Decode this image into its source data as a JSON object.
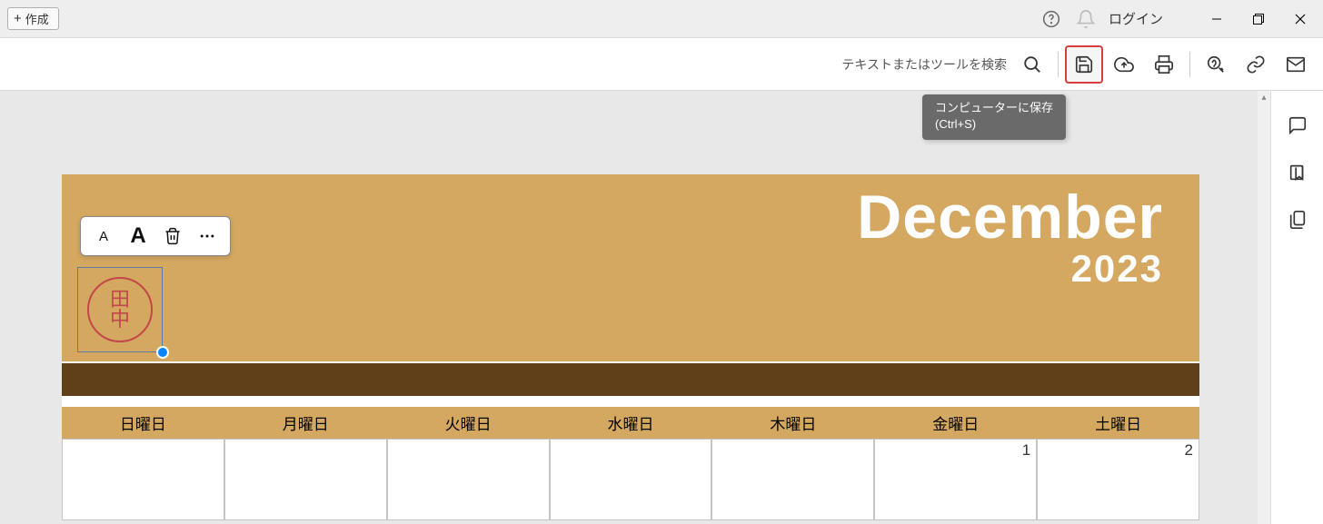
{
  "titlebar": {
    "create_label": "作成",
    "login_label": "ログイン"
  },
  "toolbar": {
    "search_placeholder": "テキストまたはツールを検索"
  },
  "tooltip": {
    "line1": "コンピューターに保存",
    "line2": "(Ctrl+S)"
  },
  "document": {
    "month": "December",
    "year": "2023",
    "weekdays": [
      "日曜日",
      "月曜日",
      "火曜日",
      "水曜日",
      "木曜日",
      "金曜日",
      "土曜日"
    ],
    "row1": [
      "",
      "",
      "",
      "",
      "",
      "1",
      "2"
    ]
  },
  "stamp": {
    "char1": "田",
    "char2": "中"
  }
}
